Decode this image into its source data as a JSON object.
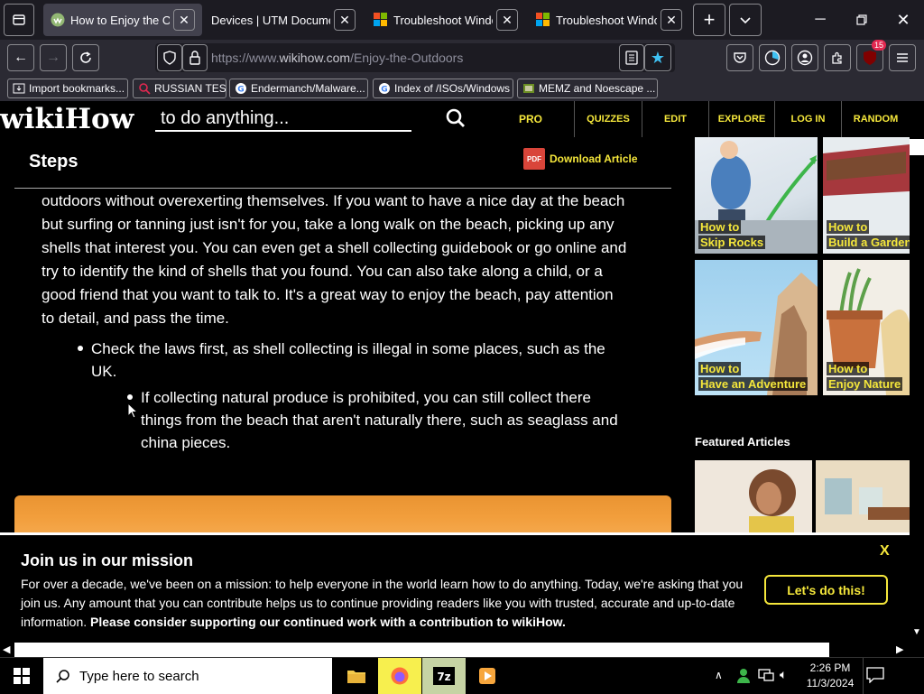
{
  "tabs": [
    {
      "title": "How to Enjoy the Outdoors",
      "active": true,
      "favicon": "wikihow-icon"
    },
    {
      "title": "Devices | UTM Documentation",
      "active": false,
      "favicon": "none"
    },
    {
      "title": "Troubleshoot Windows",
      "active": false,
      "favicon": "microsoft-icon"
    },
    {
      "title": "Troubleshoot Windows",
      "active": false,
      "favicon": "microsoft-icon"
    }
  ],
  "navbar": {
    "url_prefix": "https://www.",
    "url_domain": "wikihow.com",
    "url_path": "/Enjoy-the-Outdoors",
    "notification_count": "15"
  },
  "bookmarks": [
    {
      "label": "Import bookmarks...",
      "icon": "import-icon"
    },
    {
      "label": "RUSSIAN TEST",
      "icon": "search-icon"
    },
    {
      "label": "Endermanch/Malware...",
      "icon": "google-icon"
    },
    {
      "label": "Index of /ISOs/Windows",
      "icon": "google-icon"
    },
    {
      "label": "MEMZ and Noescape ...",
      "icon": "image-icon"
    }
  ],
  "site": {
    "logo_wiki": "wiki",
    "logo_how": "How",
    "search_placeholder": "to do anything...",
    "nav": [
      "PRO",
      "QUIZZES",
      "EDIT",
      "EXPLORE",
      "LOG IN",
      "RANDOM"
    ]
  },
  "article": {
    "section_title": "Steps",
    "download_label": "Download Article",
    "pdf_label": "PDF",
    "paragraph": "outdoors without overexerting themselves. If you want to have a nice day at the beach but surfing or tanning just isn't for you, take a long walk on the beach, picking up any shells that interest you. You can even get a shell collecting guidebook or go online and try to identify the kind of shells that you found. You can also take along a child, or a good friend that you want to talk to. It's a great way to enjoy the beach, pay attention to detail, and pass the time.",
    "bullet1": "Check the laws first, as shell collecting is illegal in some places, such as the UK.",
    "bullet2": "If collecting natural produce is prohibited, you can still collect there things from the beach that aren't naturally there, such as seaglass and china pieces."
  },
  "sidebar": {
    "related": [
      {
        "prefix": "How to",
        "title": "Skip Rocks"
      },
      {
        "prefix": "How to",
        "title": "Build a Garden Tractor Snowplow"
      },
      {
        "prefix": "How to",
        "title": "Have an Adventure"
      },
      {
        "prefix": "How to",
        "title": "Enjoy Nature"
      }
    ],
    "featured_title": "Featured Articles"
  },
  "banner": {
    "title": "Join us in our mission",
    "text": "For over a decade, we've been on a mission: to help everyone in the world learn how to do anything. Today, we're asking that you join us. Any amount that you can contribute helps us to continue providing readers like you with trusted, accurate and up-to-date information.",
    "bold_text": "Please consider supporting our continued work with a contribution to wikiHow.",
    "cta": "Let's do this!",
    "close": "X"
  },
  "taskbar": {
    "search_placeholder": "Type here to search",
    "time": "2:26 PM",
    "date": "11/3/2024"
  },
  "colors": {
    "accent_yellow": "#f5e73b",
    "chrome_dark": "#1c1b22",
    "chrome_mid": "#2b2a33"
  }
}
